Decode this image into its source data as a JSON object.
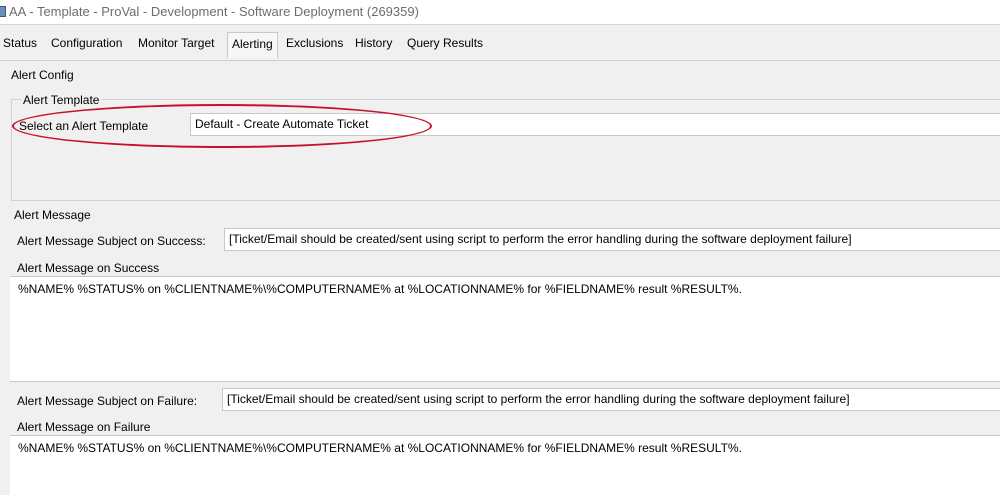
{
  "window": {
    "title": "AA - Template - ProVal - Development - Software Deployment (269359)",
    "icon": "app-window-icon"
  },
  "tabs": [
    {
      "label": "Status",
      "active": false
    },
    {
      "label": "Configuration",
      "active": false
    },
    {
      "label": "Monitor Target",
      "active": false
    },
    {
      "label": "Alerting",
      "active": true
    },
    {
      "label": "Exclusions",
      "active": false
    },
    {
      "label": "History",
      "active": false
    },
    {
      "label": "Query Results",
      "active": false
    }
  ],
  "alert_config": {
    "title": "Alert Config",
    "template_group_title": "Alert Template",
    "select_label": "Select an Alert Template",
    "selected_template": "Default - Create Automate Ticket"
  },
  "alert_message": {
    "title": "Alert Message",
    "subject_success_label": "Alert Message Subject on Success:",
    "subject_success_value": "[Ticket/Email should be created/sent using script to perform the error handling during the software deployment failure]",
    "message_success_label": "Alert Message on Success",
    "message_success_value": "%NAME% %STATUS% on %CLIENTNAME%\\%COMPUTERNAME% at %LOCATIONNAME% for %FIELDNAME% result %RESULT%.",
    "subject_failure_label": "Alert Message Subject on Failure:",
    "subject_failure_value": "[Ticket/Email should be created/sent using script to perform the error handling during the software deployment failure]",
    "message_failure_label": "Alert Message on Failure",
    "message_failure_value": "%NAME% %STATUS% on %CLIENTNAME%\\%COMPUTERNAME% at %LOCATIONNAME% for %FIELDNAME% result %RESULT%."
  },
  "colors": {
    "annotation": "#c8102e",
    "background": "#f0f0f0"
  }
}
